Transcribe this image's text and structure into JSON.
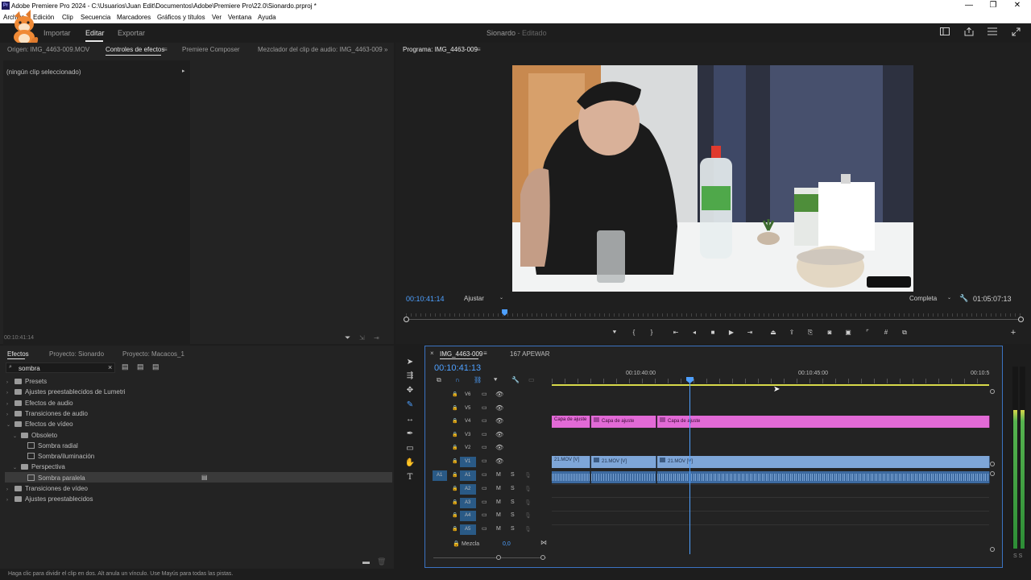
{
  "window": {
    "app_icon": "Pr",
    "title": "Adobe Premiere Pro 2024 - C:\\Usuarios\\Juan Edit\\Documentos\\Adobe\\Premiere Pro\\22.0\\Sionardo.prproj *",
    "controls": {
      "minimize": "—",
      "maximize": "❐",
      "close": "✕"
    }
  },
  "menu": [
    "Archivo",
    "Edición",
    "Clip",
    "Secuencia",
    "Marcadores",
    "Gráficos y títulos",
    "Ver",
    "Ventana",
    "Ayuda"
  ],
  "header": {
    "tabs": {
      "import": "Importar",
      "edit": "Editar",
      "export": "Exportar"
    },
    "project_name": "Sionardo",
    "project_state": "- Editado",
    "icons": [
      "workspace-icon",
      "share-icon",
      "menu-icon",
      "fullscreen-icon"
    ]
  },
  "source_panel": {
    "tabs": {
      "origin": "Origen: IMG_4463-009.MOV",
      "effect_controls": "Controles de efectos",
      "composer": "Premiere Composer",
      "mixer": "Mezclador del clip de audio: IMG_4463-009"
    },
    "expand": "»",
    "no_clip": "(ningún clip seleccionado)",
    "timecode": "00:10:41:14"
  },
  "program_monitor": {
    "title": "Programa: IMG_4463-009",
    "timecode": "00:10:41:14",
    "fit": "Ajustar",
    "quality": "Completa",
    "duration": "01:05:07:13",
    "playhead_fraction": 0.16
  },
  "effects_panel": {
    "tabs": {
      "effects": "Efectos",
      "project": "Proyecto: Sionardo",
      "project2": "Proyecto: Macacos_1"
    },
    "search_value": "sombra",
    "clear": "×",
    "tree": [
      {
        "label": "Presets",
        "level": 0,
        "type": "folder",
        "expanded": false
      },
      {
        "label": "Ajustes preestablecidos de Lumetri",
        "level": 0,
        "type": "folder",
        "expanded": false
      },
      {
        "label": "Efectos de audio",
        "level": 0,
        "type": "folder",
        "expanded": false
      },
      {
        "label": "Transiciones de audio",
        "level": 0,
        "type": "folder",
        "expanded": false
      },
      {
        "label": "Efectos de vídeo",
        "level": 0,
        "type": "folder",
        "expanded": true
      },
      {
        "label": "Obsoleto",
        "level": 1,
        "type": "folder",
        "expanded": true
      },
      {
        "label": "Sombra radial",
        "level": 2,
        "type": "effect"
      },
      {
        "label": "Sombra/iluminación",
        "level": 2,
        "type": "effect"
      },
      {
        "label": "Perspectiva",
        "level": 1,
        "type": "folder",
        "expanded": true
      },
      {
        "label": "Sombra paralela",
        "level": 2,
        "type": "effect",
        "selected": true
      },
      {
        "label": "Transiciones de vídeo",
        "level": 0,
        "type": "folder",
        "expanded": false
      },
      {
        "label": "Ajustes preestablecidos",
        "level": 0,
        "type": "folder",
        "expanded": false
      }
    ]
  },
  "timeline": {
    "tabs": {
      "close": "×",
      "sequence": "IMG_4463-009",
      "other": "167 APEWAR"
    },
    "timecode": "00:10:41:13",
    "ruler": [
      "00:10:40:00",
      "00:10:45:00",
      "00:10:5"
    ],
    "video_tracks": [
      "V6",
      "V5",
      "V4",
      "V3",
      "V2",
      "V1"
    ],
    "audio_tracks": [
      "A1",
      "A2",
      "A3",
      "A4",
      "A5"
    ],
    "source_patch": "A1",
    "mute": "M",
    "solo": "S",
    "mix_label": "Mezcla",
    "mix_value": "0,0",
    "v4_clips": [
      "Capa de ajuste",
      "Capa de ajuste",
      "Capa de ajuste"
    ],
    "v1_clips": [
      "21.MOV [V]",
      "21.MOV [V]",
      "21.MOV [V]"
    ]
  },
  "meters": {
    "labels": "S S"
  },
  "status": "Haga clic para dividir el clip en dos. Alt anula un vínculo. Use Mayús para todas las pistas.",
  "colors": {
    "accent": "#4ea0ff",
    "adjustment_clip": "#e26ad6",
    "video_clip": "#7ea6d8",
    "audio_clip": "#3d6aa0",
    "timeline_border": "#3b73c2"
  }
}
